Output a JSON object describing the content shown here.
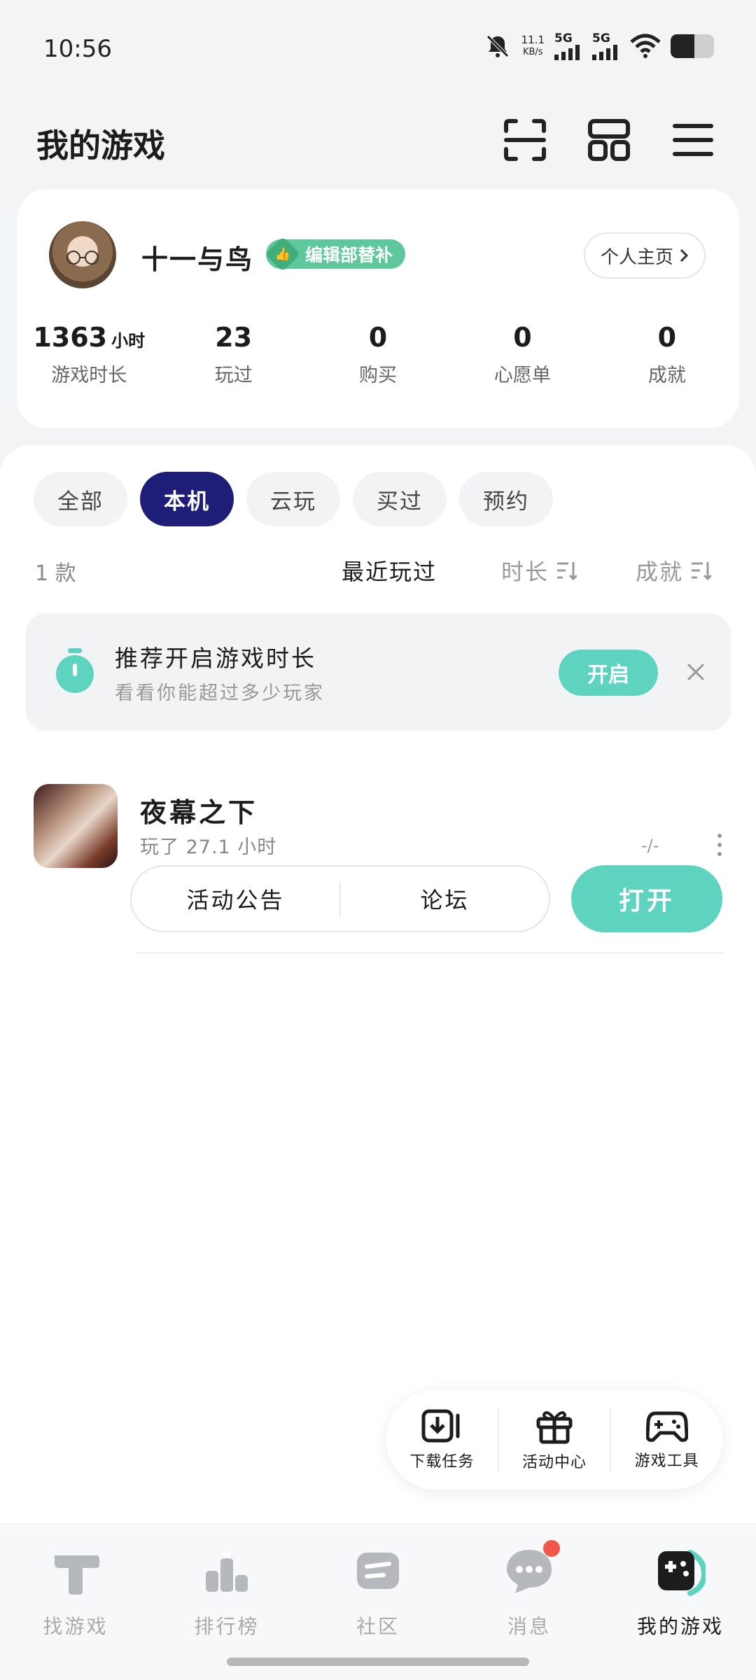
{
  "status_bar": {
    "time": "10:56",
    "net_speed_value": "11.1",
    "net_speed_unit": "KB/s",
    "sim1_label": "5G",
    "sim2_label": "5G",
    "battery_level": 0.55
  },
  "header": {
    "title": "我的游戏",
    "icons": [
      "scan-icon",
      "grid-icon",
      "menu-icon"
    ]
  },
  "profile": {
    "username": "十一与鸟",
    "badge": "编辑部替补",
    "profile_link": "个人主页",
    "stats": [
      {
        "value": "1363",
        "unit": "小时",
        "label": "游戏时长"
      },
      {
        "value": "23",
        "label": "玩过"
      },
      {
        "value": "0",
        "label": "购买"
      },
      {
        "value": "0",
        "label": "心愿单"
      },
      {
        "value": "0",
        "label": "成就"
      }
    ]
  },
  "filters": {
    "tabs": [
      {
        "label": "全部",
        "active": false
      },
      {
        "label": "本机",
        "active": true
      },
      {
        "label": "云玩",
        "active": false
      },
      {
        "label": "买过",
        "active": false
      },
      {
        "label": "预约",
        "active": false
      }
    ]
  },
  "sort": {
    "count": "1 款",
    "recent": "最近玩过",
    "duration": "时长",
    "achievement": "成就"
  },
  "promo": {
    "title": "推荐开启游戏时长",
    "subtitle": "看看你能超过多少玩家",
    "button": "开启"
  },
  "game": {
    "name": "夜幕之下",
    "played": "玩了 27.1 小时",
    "rating": "-/-",
    "actions": [
      "活动公告",
      "论坛"
    ],
    "open_button": "打开"
  },
  "toolbox": {
    "items": [
      {
        "label": "下载任务",
        "icon": "download-task-icon"
      },
      {
        "label": "活动中心",
        "icon": "gift-icon"
      },
      {
        "label": "游戏工具",
        "icon": "gamepad-icon"
      }
    ]
  },
  "bottom_nav": {
    "items": [
      {
        "label": "找游戏",
        "icon": "find-game-icon",
        "active": false
      },
      {
        "label": "排行榜",
        "icon": "ranking-icon",
        "active": false
      },
      {
        "label": "社区",
        "icon": "community-icon",
        "active": false
      },
      {
        "label": "消息",
        "icon": "message-icon",
        "active": false,
        "badge": true
      },
      {
        "label": "我的游戏",
        "icon": "my-games-icon",
        "active": true
      }
    ]
  },
  "colors": {
    "accent": "#5ed3c0",
    "active_tab": "#1e1e78",
    "badge_green": "#5fc79c",
    "notification_red": "#f4574a"
  }
}
